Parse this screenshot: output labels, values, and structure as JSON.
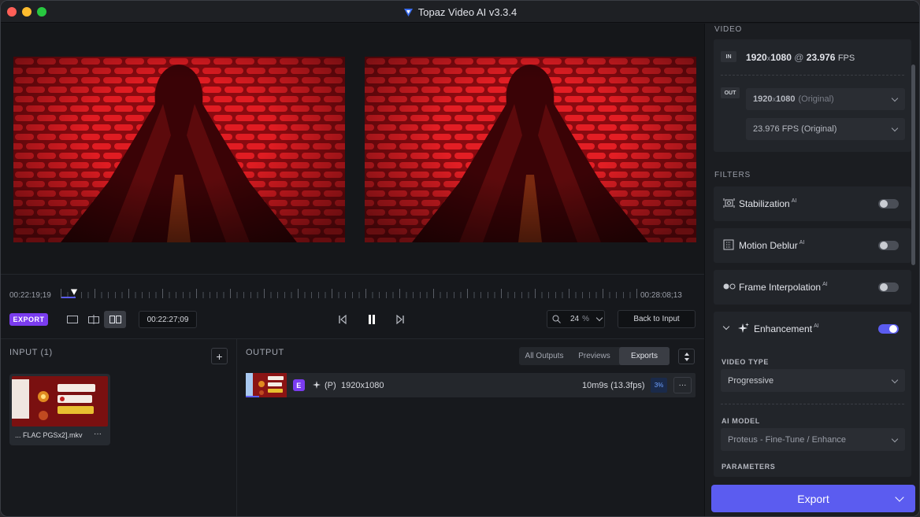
{
  "window": {
    "title": "Topaz Video AI  v3.3.4"
  },
  "colors": {
    "accent": "#5b5cf0",
    "export_purple": "#7b3cf0",
    "traffic_red": "#ff5f57",
    "traffic_yellow": "#febc2e",
    "traffic_green": "#28c840"
  },
  "timeline": {
    "start_tc": "00:22:19;19",
    "end_tc": "00:28:08;13",
    "export_label": "EXPORT",
    "current_tc": "00:22:27;09",
    "zoom_value": "24",
    "zoom_unit": "%",
    "back_to_input": "Back to Input"
  },
  "input_panel": {
    "title": "INPUT (1)",
    "add_icon": "+",
    "file_name": "... FLAC PGSx2].mkv",
    "more": "···"
  },
  "output_panel": {
    "title": "OUTPUT",
    "tabs": [
      "All Outputs",
      "Previews",
      "Exports"
    ],
    "active_tab": "Exports",
    "row": {
      "badge": "E",
      "mode": "(P)",
      "resolution": "1920x1080",
      "time": "10m9s (13.3fps)",
      "progress": "3%",
      "more": "···"
    }
  },
  "sidebar": {
    "video_header": "VIDEO",
    "in_tag": "IN",
    "in_res_w": "1920",
    "in_res_x": "x",
    "in_res_h": "1080",
    "in_at": "@",
    "in_fps": "23.976",
    "in_fps_unit": "FPS",
    "out_tag": "OUT",
    "out_res_bold": "1920",
    "out_res_x": "x",
    "out_res_h": "1080",
    "out_res_note": "(Original)",
    "out_fps": "23.976 FPS (Original)",
    "filters_header": "FILTERS",
    "filters": [
      {
        "label": "Stabilization",
        "ai": "AI",
        "on": false
      },
      {
        "label": "Motion Deblur",
        "ai": "AI",
        "on": false
      },
      {
        "label": "Frame Interpolation",
        "ai": "AI",
        "on": false
      }
    ],
    "enhancement": {
      "label": "Enhancement",
      "ai": "AI",
      "on": true,
      "video_type_label": "VIDEO TYPE",
      "video_type": "Progressive",
      "ai_model_label": "AI MODEL",
      "ai_model": "Proteus - Fine-Tune / Enhance",
      "parameters_label": "PARAMETERS"
    },
    "export_button": "Export"
  }
}
